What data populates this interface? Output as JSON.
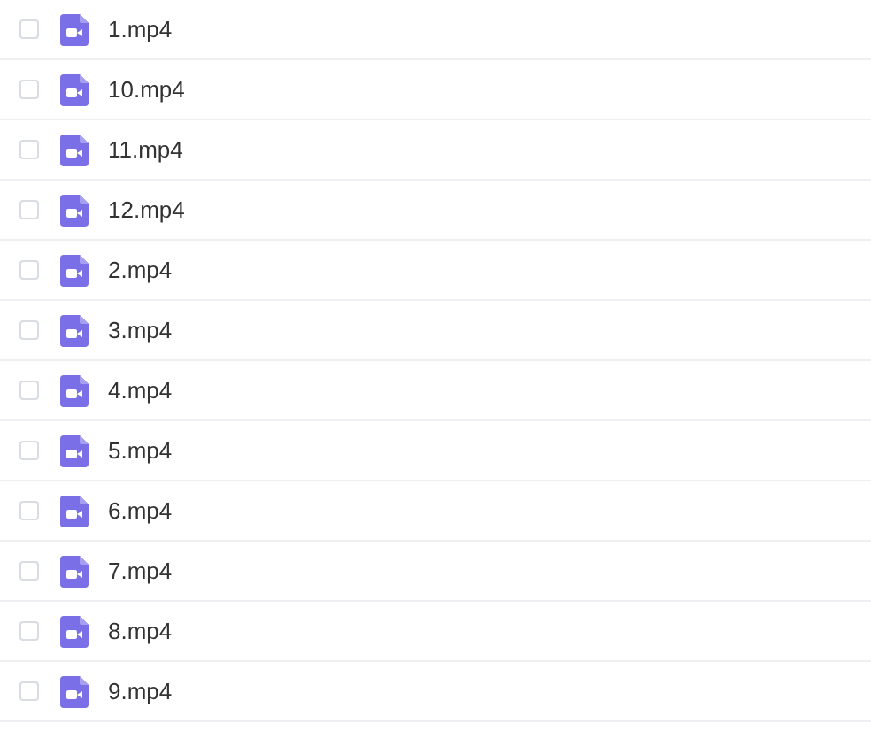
{
  "files": [
    {
      "name": "1.mp4",
      "checked": false
    },
    {
      "name": "10.mp4",
      "checked": false
    },
    {
      "name": "11.mp4",
      "checked": false
    },
    {
      "name": "12.mp4",
      "checked": false
    },
    {
      "name": "2.mp4",
      "checked": false
    },
    {
      "name": "3.mp4",
      "checked": false
    },
    {
      "name": "4.mp4",
      "checked": false
    },
    {
      "name": "5.mp4",
      "checked": false
    },
    {
      "name": "6.mp4",
      "checked": false
    },
    {
      "name": "7.mp4",
      "checked": false
    },
    {
      "name": "8.mp4",
      "checked": false
    },
    {
      "name": "9.mp4",
      "checked": false
    }
  ]
}
